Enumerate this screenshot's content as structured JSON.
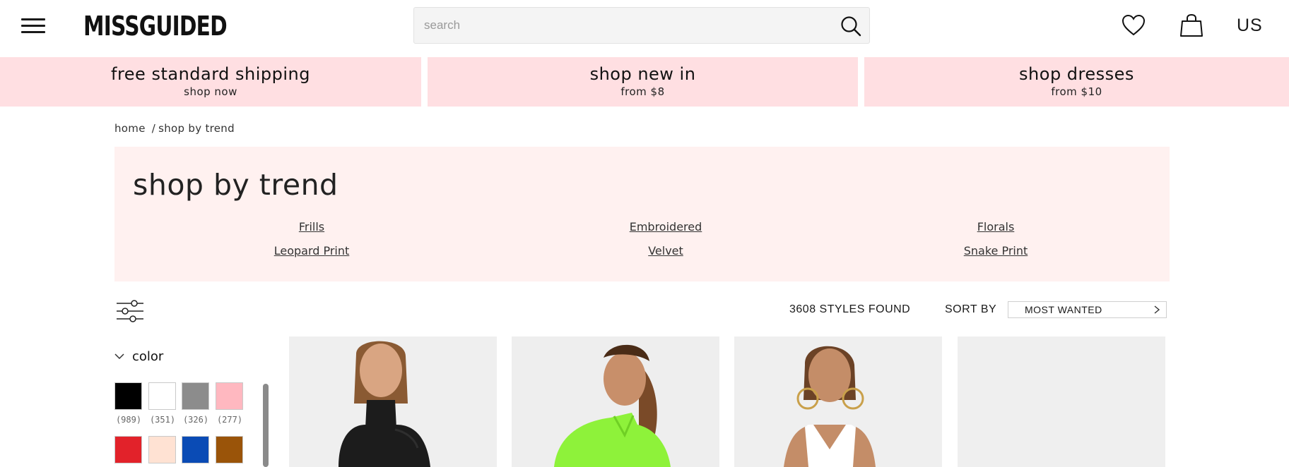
{
  "header": {
    "logo": "MISSGUIDED",
    "search": {
      "placeholder": "search",
      "value": ""
    },
    "region_label": "US"
  },
  "promos": [
    {
      "title": "free standard shipping",
      "subtitle": "shop now"
    },
    {
      "title": "shop new in",
      "subtitle": "from $8"
    },
    {
      "title": "shop dresses",
      "subtitle": "from $10"
    }
  ],
  "breadcrumb": {
    "home": "home",
    "separator": "/",
    "current": "shop by trend"
  },
  "trend": {
    "title": "shop by trend",
    "links": [
      "Frills",
      "Embroidered",
      "Florals",
      "Leopard Print",
      "Velvet",
      "Snake Print"
    ]
  },
  "toolbar": {
    "styles_found": "3608 STYLES FOUND",
    "sort_label": "SORT BY",
    "sort_value": "MOST WANTED"
  },
  "filters": {
    "color": {
      "label": "color",
      "swatches": [
        {
          "color": "#000000",
          "count": "(989)"
        },
        {
          "color": "#ffffff",
          "count": "(351)"
        },
        {
          "color": "#8c8c8c",
          "count": "(326)"
        },
        {
          "color": "#ffb8c0",
          "count": "(277)"
        },
        {
          "color": "#e2222a",
          "count": ""
        },
        {
          "color": "#ffe2d3",
          "count": ""
        },
        {
          "color": "#0a4bb5",
          "count": ""
        },
        {
          "color": "#9a5409",
          "count": ""
        }
      ]
    }
  },
  "products": [
    {
      "image": "model-black-turtleneck",
      "color": "#1c1c1c"
    },
    {
      "image": "model-neon-green-top",
      "color": "#8ef23a"
    },
    {
      "image": "model-white-vest",
      "color": "#ffffff"
    },
    {
      "image": "image-loading",
      "color": "#efefef"
    }
  ]
}
